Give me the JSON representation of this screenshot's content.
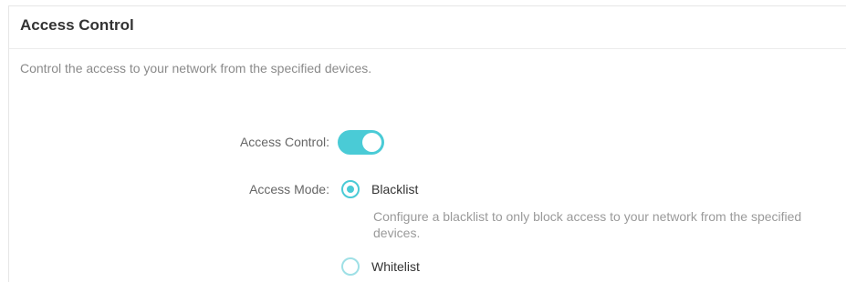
{
  "section": {
    "title": "Access Control",
    "description": "Control the access to your network from the specified devices."
  },
  "access_control": {
    "label": "Access Control:",
    "toggle_state": "on",
    "accent_color": "#4acbd6"
  },
  "access_mode": {
    "label": "Access Mode:",
    "options": [
      {
        "label": "Blacklist",
        "selected": true,
        "description": "Configure a blacklist to only block access to your network from the specified devices."
      },
      {
        "label": "Whitelist",
        "selected": false
      }
    ]
  }
}
